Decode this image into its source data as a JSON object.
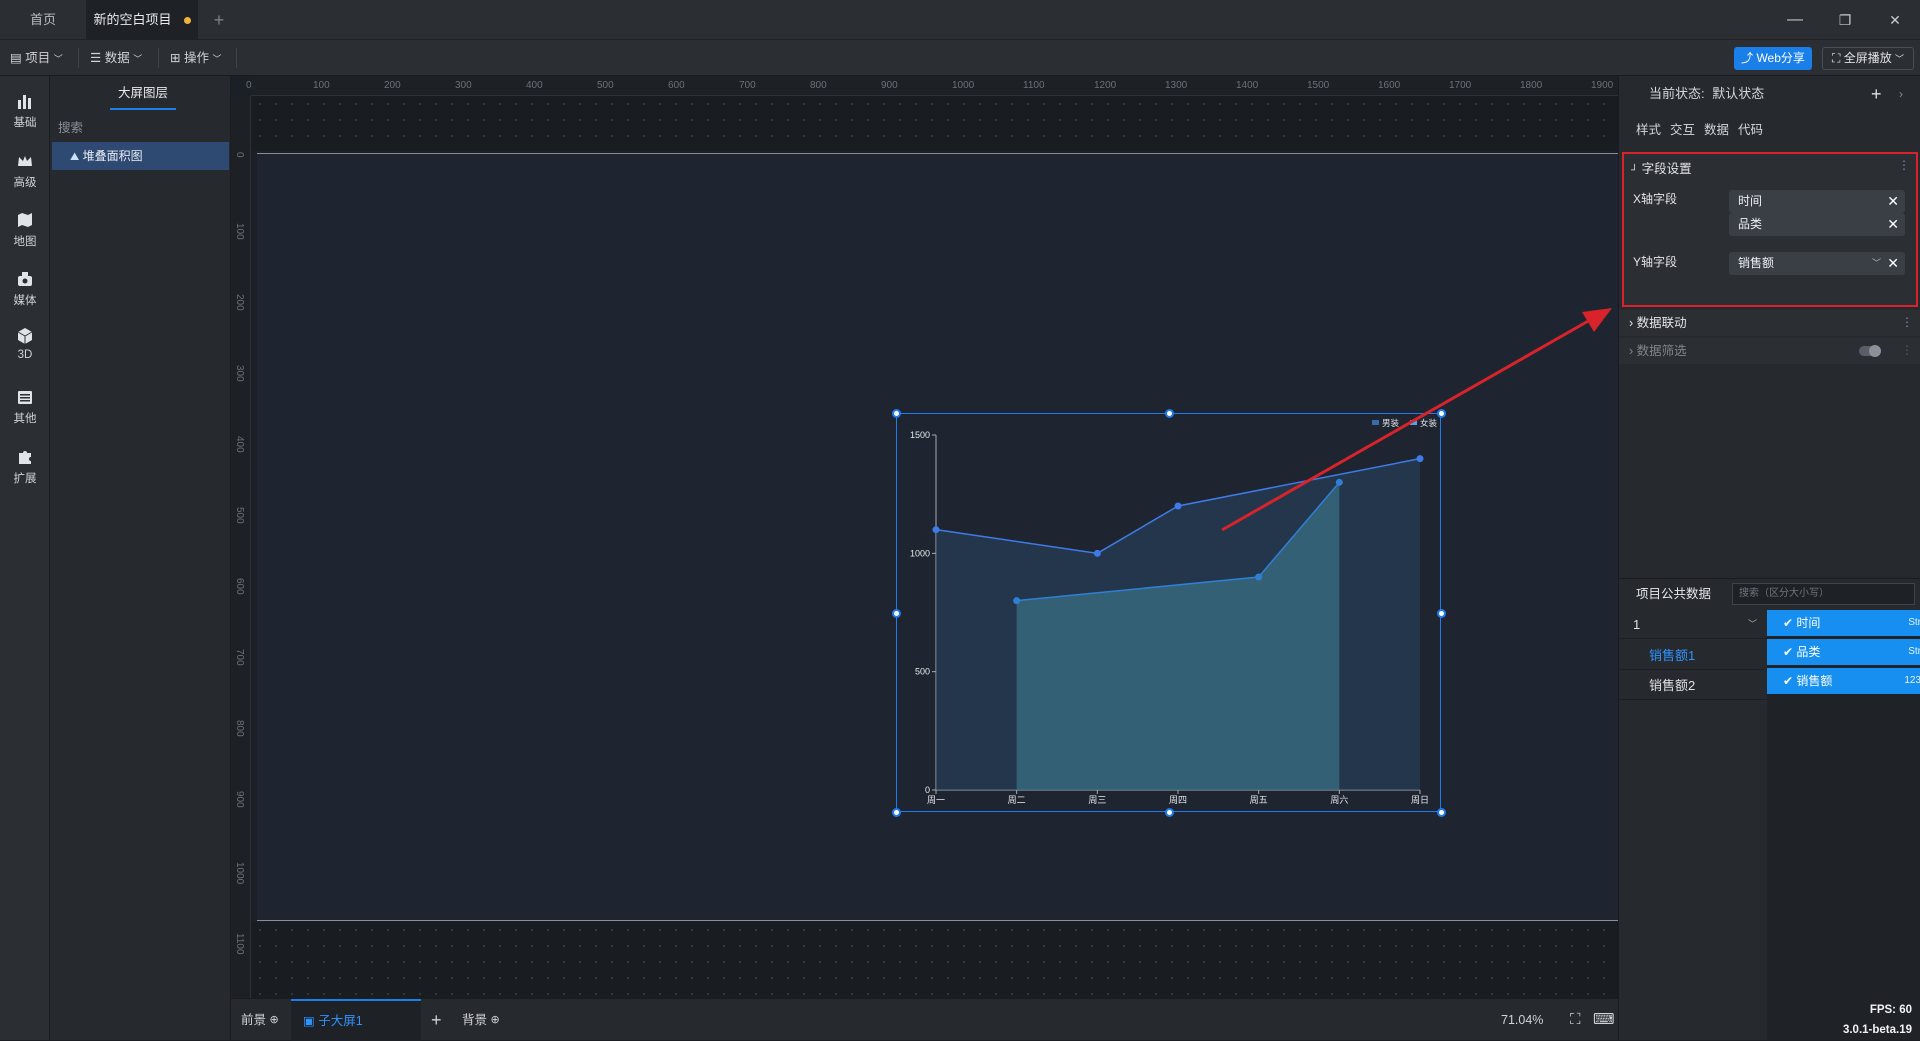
{
  "titlebar": {
    "tab_home": "首页",
    "tab_project": "新的空白项目",
    "add_tab": "+",
    "minimize": "—",
    "restore": "❐",
    "close": "✕"
  },
  "toolbar": {
    "project": "项目",
    "data": "数据",
    "ops": "操作",
    "webshare": "Web分享",
    "fullscreen": "全屏播放"
  },
  "rail": [
    {
      "label": "基础",
      "icon": "bar-chart-icon"
    },
    {
      "label": "高级",
      "icon": "crown-icon"
    },
    {
      "label": "地图",
      "icon": "map-icon"
    },
    {
      "label": "媒体",
      "icon": "media-icon"
    },
    {
      "label": "3D",
      "icon": "cube-icon"
    },
    {
      "label": "其他",
      "icon": "list-icon"
    },
    {
      "label": "扩展",
      "icon": "puzzle-icon"
    }
  ],
  "layers": {
    "title": "大屏图层",
    "search": "搜索",
    "item": "堆叠面积图"
  },
  "rulers": {
    "top": [
      "0",
      "100",
      "200",
      "300",
      "400",
      "500",
      "600",
      "700",
      "800",
      "900",
      "1000",
      "1100",
      "1200",
      "1300",
      "1400",
      "1500",
      "1600",
      "1700",
      "1800",
      "1900"
    ],
    "left": [
      "0",
      "100",
      "200",
      "300",
      "400",
      "500",
      "600",
      "700",
      "800",
      "900",
      "1000",
      "1100"
    ]
  },
  "chart_data": {
    "type": "area",
    "categories": [
      "周一",
      "周二",
      "周三",
      "周四",
      "周五",
      "周六",
      "周日"
    ],
    "ylim": [
      0,
      1500
    ],
    "yticks": [
      "0",
      "500",
      "1000",
      "1500"
    ],
    "legend_position": "top-right",
    "series": [
      {
        "name": "男装",
        "values": [
          1100,
          null,
          1000,
          1200,
          null,
          null,
          1400
        ],
        "color": "#3f7be8"
      },
      {
        "name": "女装",
        "values": [
          null,
          800,
          null,
          null,
          900,
          1300,
          null
        ],
        "color": "#2f7fd6"
      }
    ]
  },
  "bottombar": {
    "foreground": "前景",
    "subscreen": "子大屏1",
    "add": "+",
    "background": "背景",
    "zoom": "71.04%"
  },
  "rpanel": {
    "state_label": "当前状态:",
    "state_value": "默认状态",
    "tabs": [
      "样式",
      "交互",
      "数据",
      "代码"
    ],
    "field_settings": "字段设置",
    "x_field_label": "X轴字段",
    "x_fields": [
      "时间",
      "品类"
    ],
    "y_field_label": "Y轴字段",
    "y_field": "销售额",
    "data_link": "数据联动",
    "data_filter": "数据筛选",
    "public_data": "项目公共数据",
    "public_search_placeholder": "搜索（区分大小写）",
    "dataset_group": "1",
    "datasets": [
      "销售额1",
      "销售额2"
    ],
    "fields": [
      {
        "name": "时间",
        "type": "Str"
      },
      {
        "name": "品类",
        "type": "Str"
      },
      {
        "name": "销售额",
        "type": "123"
      }
    ]
  },
  "status": {
    "fps": "FPS: 60",
    "version": "3.0.1-beta.19"
  },
  "colors": {
    "accent": "#1a7fe8",
    "highlight_border": "#d8232a"
  }
}
